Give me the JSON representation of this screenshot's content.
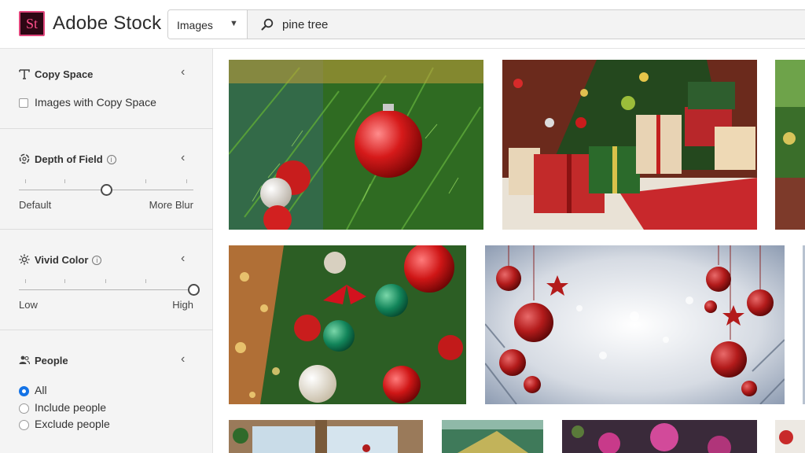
{
  "header": {
    "logo_text": "St",
    "brand": "Adobe Stock",
    "search": {
      "type": "Images",
      "query": "pine tree"
    }
  },
  "sidebar": {
    "copy_space": {
      "title": "Copy Space",
      "option": "Images with Copy Space",
      "checked": false
    },
    "depth_of_field": {
      "title": "Depth of Field",
      "min_label": "Default",
      "max_label": "More Blur",
      "level": 0.5
    },
    "vivid_color": {
      "title": "Vivid Color",
      "min_label": "Low",
      "max_label": "High",
      "level": 1.0
    },
    "people": {
      "title": "People",
      "options": [
        "All",
        "Include people",
        "Exclude people"
      ],
      "selected": "All"
    }
  },
  "colors": {
    "accent": "#1473e6",
    "brand_pink": "#ff4f8b",
    "brand_bg": "#2d0714"
  },
  "results": [
    {
      "name": "christmas-tree-red-ornament"
    },
    {
      "name": "christmas-tree-with-gifts"
    },
    {
      "name": "partial-tree-image"
    },
    {
      "name": "christmas-tree-bokeh-ornaments"
    },
    {
      "name": "hanging-red-ornaments-snow"
    },
    {
      "name": "window-christmas-scene"
    },
    {
      "name": "pine-branch-snow"
    },
    {
      "name": "pink-flowers"
    },
    {
      "name": "edge-ornament-image"
    }
  ]
}
